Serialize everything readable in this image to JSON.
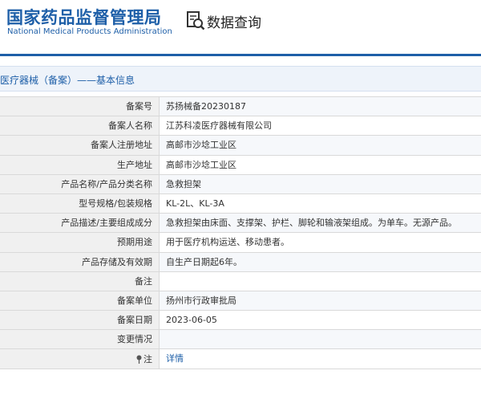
{
  "header": {
    "logo_cn": "国家药品监督管理局",
    "logo_en": "National Medical Products Administration",
    "search_title": "数据查询"
  },
  "section": {
    "title": "医疗器械（备案）——基本信息"
  },
  "rows": [
    {
      "label": "备案号",
      "value": "苏扬械备20230187"
    },
    {
      "label": "备案人名称",
      "value": "江苏科凌医疗器械有限公司"
    },
    {
      "label": "备案人注册地址",
      "value": "高邮市沙埝工业区"
    },
    {
      "label": "生产地址",
      "value": "高邮市沙埝工业区"
    },
    {
      "label": "产品名称/产品分类名称",
      "value": "急救担架"
    },
    {
      "label": "型号规格/包装规格",
      "value": "KL-2L、KL-3A"
    },
    {
      "label": "产品描述/主要组成成分",
      "value": "急救担架由床面、支撑架、护栏、脚轮和输液架组成。为单车。无源产品。"
    },
    {
      "label": "预期用途",
      "value": "用于医疗机构运送、移动患者。"
    },
    {
      "label": "产品存储及有效期",
      "value": "自生产日期起6年。"
    },
    {
      "label": "备注",
      "value": ""
    },
    {
      "label": "备案单位",
      "value": "扬州市行政审批局"
    },
    {
      "label": "备案日期",
      "value": "2023-06-05"
    },
    {
      "label": "变更情况",
      "value": ""
    },
    {
      "label": "注",
      "value": "详情"
    }
  ],
  "colors": {
    "brand": "#1e5fa8",
    "label_bg": "#f0f0f0",
    "border": "#d9d9d9"
  },
  "icons": {
    "search": "magnifier-document-icon",
    "pin": "map-pin-icon"
  }
}
